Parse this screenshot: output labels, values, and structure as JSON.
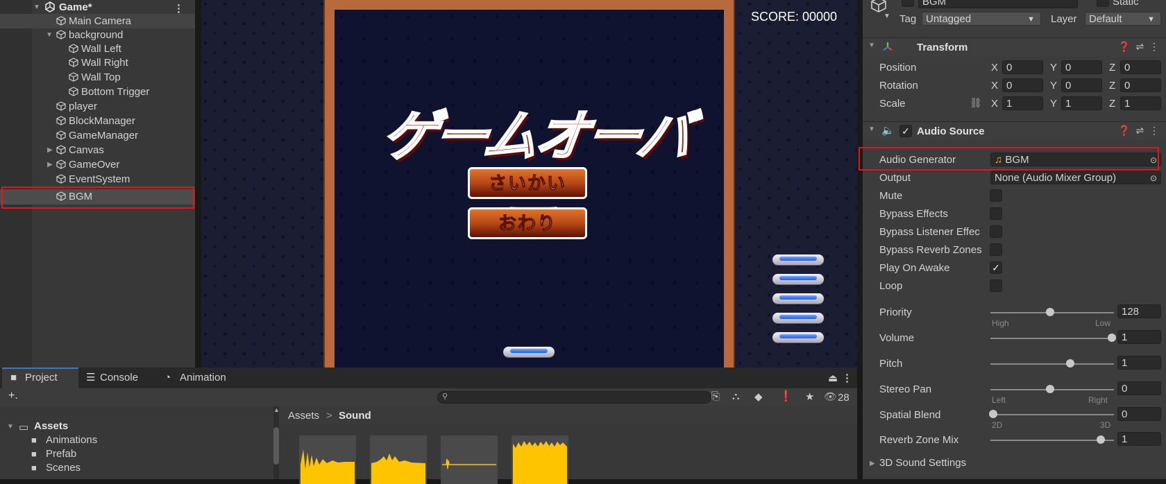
{
  "hierarchy": {
    "scene_name": "Game*",
    "items": [
      {
        "label": "Main Camera"
      },
      {
        "label": "background"
      },
      {
        "label": "Wall Left"
      },
      {
        "label": "Wall Right"
      },
      {
        "label": "Wall Top"
      },
      {
        "label": "Bottom Trigger"
      },
      {
        "label": "player"
      },
      {
        "label": "BlockManager"
      },
      {
        "label": "GameManager"
      },
      {
        "label": "Canvas"
      },
      {
        "label": "GameOver"
      },
      {
        "label": "EventSystem"
      },
      {
        "label": "BGM"
      }
    ]
  },
  "game": {
    "score": "SCORE: 00000",
    "title": "ゲームオーバー",
    "buttons": {
      "restart": "さいかい",
      "quit": "おわり"
    }
  },
  "inspector": {
    "object_name": "BGM",
    "static_label": "Static",
    "tag_label": "Tag",
    "tag_value": "Untagged",
    "layer_label": "Layer",
    "layer_value": "Default",
    "transform": {
      "title": "Transform",
      "rows": [
        {
          "label": "Position",
          "x": "0",
          "y": "0",
          "z": "0"
        },
        {
          "label": "Rotation",
          "x": "0",
          "y": "0",
          "z": "0"
        },
        {
          "label": "Scale",
          "x": "1",
          "y": "1",
          "z": "1"
        }
      ],
      "axis": {
        "x": "X",
        "y": "Y",
        "z": "Z"
      }
    },
    "audio_source": {
      "title": "Audio Source",
      "generator_label": "Audio Generator",
      "generator_value": "BGM",
      "output_label": "Output",
      "output_value": "None (Audio Mixer Group)",
      "checks": [
        {
          "label": "Mute",
          "checked": false
        },
        {
          "label": "Bypass Effects",
          "checked": false
        },
        {
          "label": "Bypass Listener Effec",
          "checked": false
        },
        {
          "label": "Bypass Reverb Zones",
          "checked": false
        },
        {
          "label": "Play On Awake",
          "checked": true
        },
        {
          "label": "Loop",
          "checked": false
        }
      ],
      "priority": {
        "label": "Priority",
        "value": "128",
        "min_label": "High",
        "max_label": "Low",
        "fraction": 0.5
      },
      "volume": {
        "label": "Volume",
        "value": "1",
        "fraction": 1.0
      },
      "pitch": {
        "label": "Pitch",
        "value": "1",
        "fraction": 0.666
      },
      "stereo_pan": {
        "label": "Stereo Pan",
        "value": "0",
        "min_label": "Left",
        "max_label": "Right",
        "fraction": 0.5
      },
      "spatial_blend": {
        "label": "Spatial Blend",
        "value": "0",
        "min_label": "2D",
        "max_label": "3D",
        "fraction": 0.0
      },
      "reverb_zone_mix": {
        "label": "Reverb Zone Mix",
        "value": "1",
        "fraction": 0.909
      },
      "sound_settings": "3D Sound Settings"
    }
  },
  "project": {
    "tabs": [
      {
        "label": "Project",
        "icon": "folder-icon"
      },
      {
        "label": "Console",
        "icon": "console-icon"
      },
      {
        "label": "Animation",
        "icon": "clock-icon"
      }
    ],
    "visible_count": "28",
    "breadcrumb": {
      "root": "Assets",
      "sep": ">",
      "current": "Sound"
    },
    "tree": [
      {
        "label": "Assets"
      },
      {
        "label": "Animations"
      },
      {
        "label": "Prefab"
      },
      {
        "label": "Scenes"
      }
    ]
  },
  "colors": {
    "highlight_box": "#e8141b",
    "waveform": "#ffc400",
    "accent_tab": "#3a79bb"
  }
}
